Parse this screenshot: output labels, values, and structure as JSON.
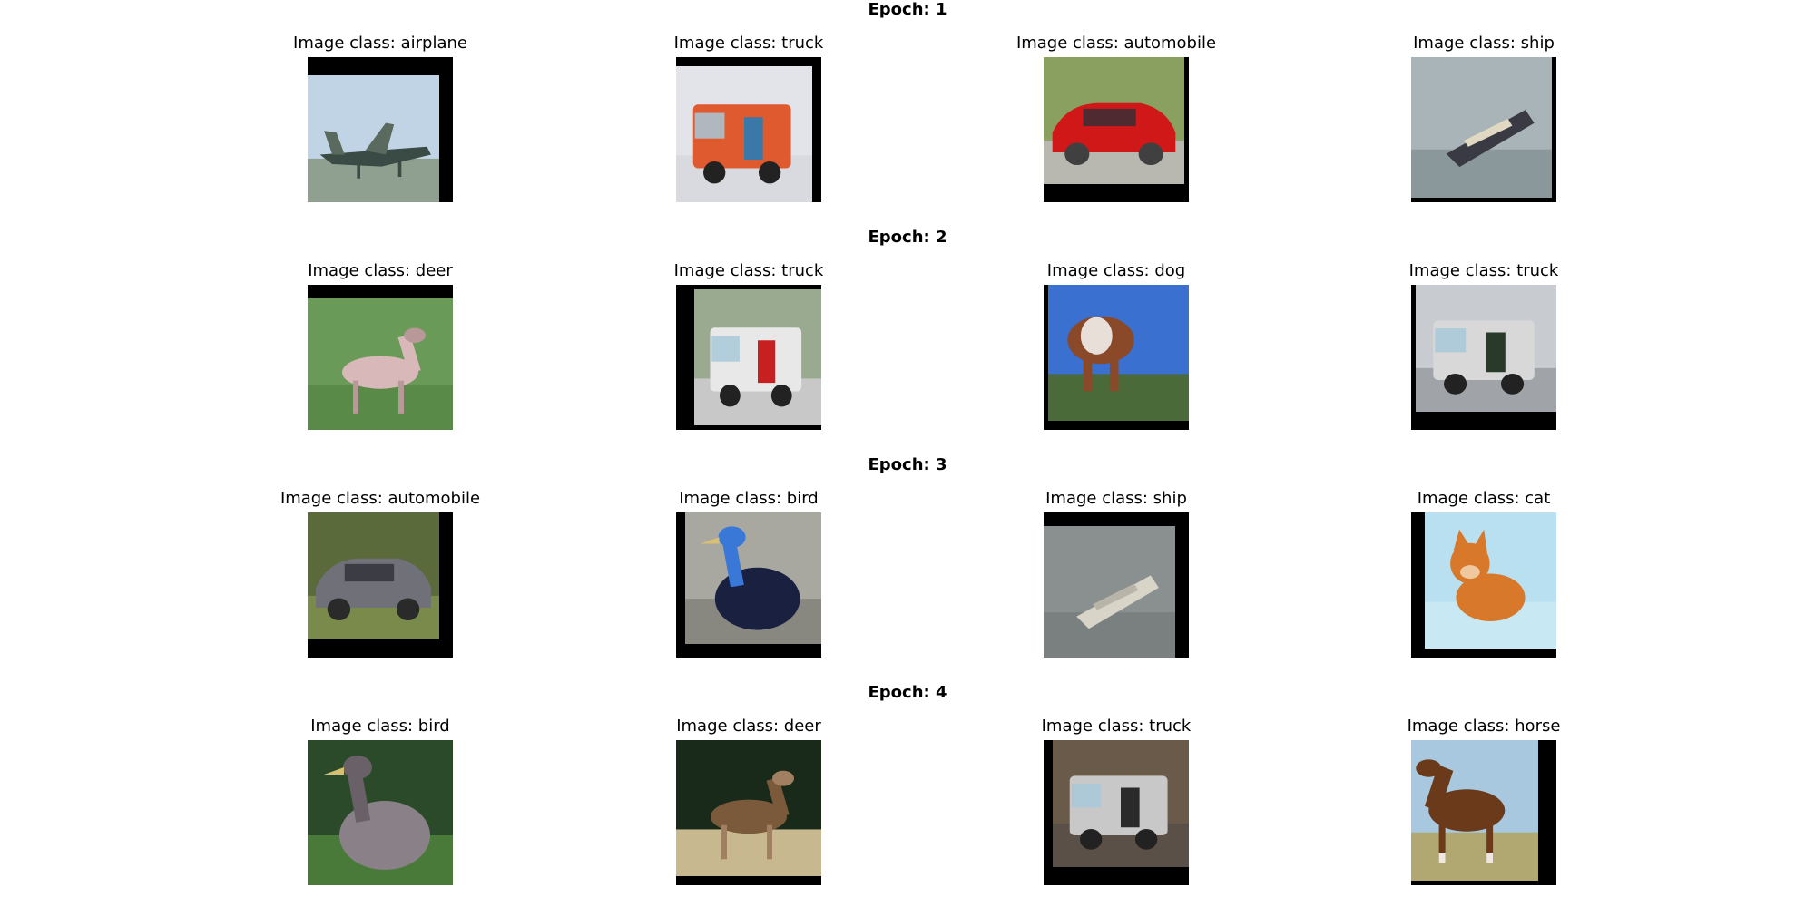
{
  "epochs": [
    {
      "title": "Epoch: 1",
      "images": [
        {
          "title": "Image class: airplane",
          "colors": {
            "bg": "#c0d4e6",
            "ground": "#90a090",
            "subject": "#3a4a44",
            "accent": "#5a6a5e"
          }
        },
        {
          "title": "Image class: truck",
          "colors": {
            "bg": "#e2e4ea",
            "ground": "#d8dae0",
            "subject": "#e05a30",
            "accent": "#3a78a8"
          }
        },
        {
          "title": "Image class: automobile",
          "colors": {
            "bg": "#8aa060",
            "ground": "#b8b8b0",
            "subject": "#d01818",
            "accent": "#404040"
          }
        },
        {
          "title": "Image class: ship",
          "colors": {
            "bg": "#a8b4b8",
            "ground": "#8a989c",
            "subject": "#3a3a44",
            "accent": "#e0d8c0"
          }
        }
      ]
    },
    {
      "title": "Epoch: 2",
      "images": [
        {
          "title": "Image class: deer",
          "colors": {
            "bg": "#6a9a58",
            "ground": "#5a8a48",
            "subject": "#d8b8b8",
            "accent": "#b89898"
          }
        },
        {
          "title": "Image class: truck",
          "colors": {
            "bg": "#9aaa90",
            "ground": "#c8c8c8",
            "subject": "#e8e8e8",
            "accent": "#c82020"
          }
        },
        {
          "title": "Image class: dog",
          "colors": {
            "bg": "#3a70d0",
            "ground": "#4a6a3a",
            "subject": "#8a4a2a",
            "accent": "#e8e0d8"
          }
        },
        {
          "title": "Image class: truck",
          "colors": {
            "bg": "#c8ccd0",
            "ground": "#a0a4a8",
            "subject": "#d8d8d8",
            "accent": "#2a3a2a"
          }
        }
      ]
    },
    {
      "title": "Epoch: 3",
      "images": [
        {
          "title": "Image class: automobile",
          "colors": {
            "bg": "#5a6a3a",
            "ground": "#7a8a4a",
            "subject": "#707078",
            "accent": "#2a2a2a"
          }
        },
        {
          "title": "Image class: bird",
          "colors": {
            "bg": "#a8a8a0",
            "ground": "#888880",
            "subject": "#1a2040",
            "accent": "#3a78d8"
          }
        },
        {
          "title": "Image class: ship",
          "colors": {
            "bg": "#8a9090",
            "ground": "#7a8080",
            "subject": "#d8d4c8",
            "accent": "#b8b4a8"
          }
        },
        {
          "title": "Image class: cat",
          "colors": {
            "bg": "#b8e0f0",
            "ground": "#c8e8f4",
            "subject": "#d8782a",
            "accent": "#f0c8a0"
          }
        }
      ]
    },
    {
      "title": "Epoch: 4",
      "images": [
        {
          "title": "Image class: bird",
          "colors": {
            "bg": "#2a4a2a",
            "ground": "#4a7a3a",
            "subject": "#8a8088",
            "accent": "#6a6068"
          }
        },
        {
          "title": "Image class: deer",
          "colors": {
            "bg": "#1a2a1a",
            "ground": "#c8b890",
            "subject": "#7a5a3a",
            "accent": "#a08060"
          }
        },
        {
          "title": "Image class: truck",
          "colors": {
            "bg": "#6a5a4a",
            "ground": "#5a5048",
            "subject": "#c8c8c8",
            "accent": "#2a2a2a"
          }
        },
        {
          "title": "Image class: horse",
          "colors": {
            "bg": "#a8c8e0",
            "ground": "#b0a870",
            "subject": "#6a3a1a",
            "accent": "#f0e8e0"
          }
        }
      ]
    }
  ]
}
